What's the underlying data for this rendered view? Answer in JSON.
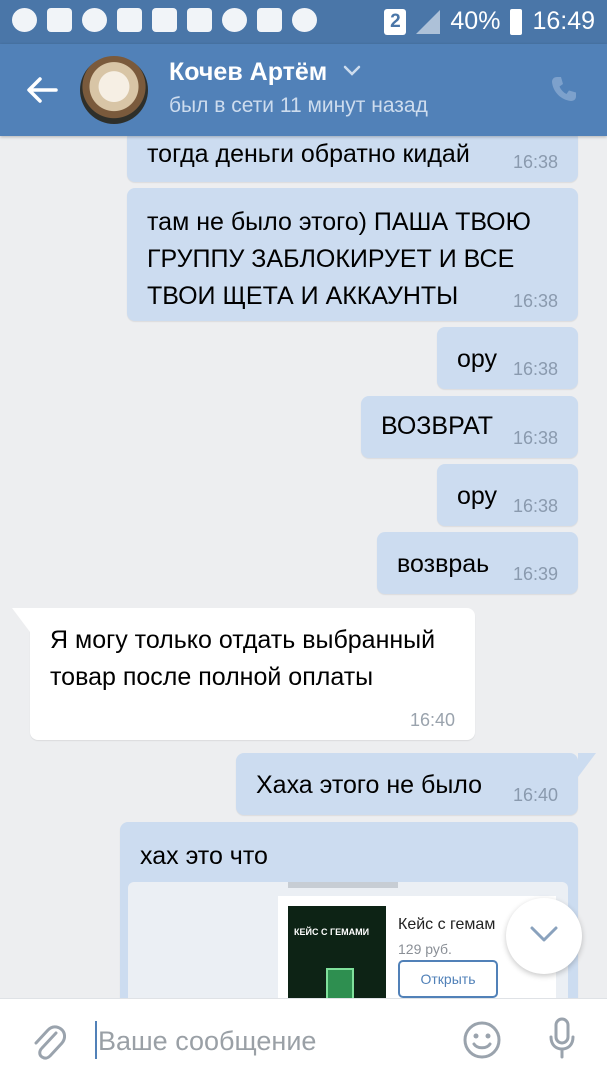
{
  "status_bar": {
    "sim_slot": "2",
    "battery": "40%",
    "time": "16:49",
    "icons": [
      "chat-icon",
      "gallery-icon",
      "search-icon",
      "video-icon",
      "game-icon",
      "game-icon",
      "message-icon",
      "mute-icon",
      "wifi-icon",
      "signal-icon",
      "battery-icon"
    ]
  },
  "header": {
    "contact_name": "Кочев Артём",
    "contact_status": "был в сети 11 минут назад"
  },
  "messages": [
    {
      "direction": "out",
      "text": "тогда деньги обратно кидай",
      "time": "16:38"
    },
    {
      "direction": "out",
      "text": "там не было этого) ПАША ТВОЮ ГРУППУ ЗАБЛОКИРУЕТ И ВСЕ ТВОИ ЩЕТА И АККАУНТЫ",
      "time": "16:38"
    },
    {
      "direction": "out",
      "text": "ору",
      "time": "16:38"
    },
    {
      "direction": "out",
      "text": "ВОЗВРАТ",
      "time": "16:38"
    },
    {
      "direction": "out",
      "text": "ору",
      "time": "16:38"
    },
    {
      "direction": "out",
      "text": "возвраь",
      "time": "16:39"
    },
    {
      "direction": "in",
      "text": "Я могу только отдать выбранный товар после полной оплаты",
      "time": "16:40"
    },
    {
      "direction": "out",
      "text": "Хаха этого не было",
      "time": "16:40"
    },
    {
      "direction": "out",
      "text": "хах это что",
      "time": ""
    }
  ],
  "attachment": {
    "thumb_caption": "КЕЙС С ГЕМАМИ",
    "title": "Кейс с гемам",
    "price": "129 руб.",
    "open_button": "Открыть"
  },
  "composer": {
    "placeholder": "Ваше сообщение"
  },
  "colors": {
    "header": "#5181b8",
    "status_bar": "#4a76a8",
    "outgoing_bubble": "#ccdcf0",
    "incoming_bubble": "#ffffff",
    "background": "#edeef0"
  }
}
